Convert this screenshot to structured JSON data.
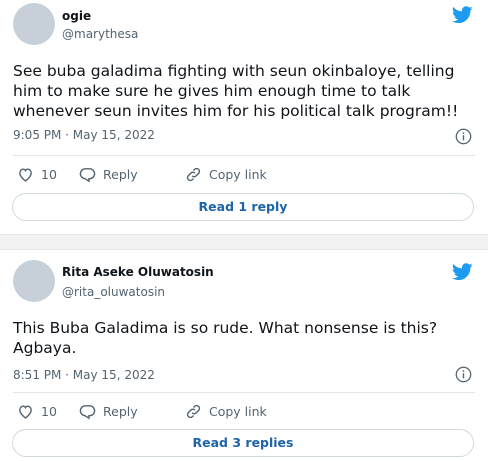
{
  "colors": {
    "twitter_blue": "#1d9bf0",
    "link_blue": "#1d64a8",
    "muted_text": "#536471",
    "avatar_placeholder": "#c7d0d8"
  },
  "tweets": [
    {
      "author_name": "ogie",
      "author_handle": "@marythesa",
      "text": "See buba galadima fighting with seun okinbaloye,  telling him to make sure he gives him enough time to talk whenever seun invites him for his political talk program!!",
      "timestamp": "9:05 PM · May 15, 2022",
      "like_count": "10",
      "reply_label": "Reply",
      "copy_link_label": "Copy link",
      "replies_button_label": "Read 1 reply",
      "icons": [
        "twitter-bird-icon",
        "info-icon",
        "heart-icon",
        "reply-icon",
        "link-icon"
      ]
    },
    {
      "author_name": "Rita Aseke Oluwatosin",
      "author_handle": "@rita_oluwatosin",
      "text": "This Buba Galadima is so rude. What nonsense is this? Agbaya.",
      "timestamp": "8:51 PM · May 15, 2022",
      "like_count": "10",
      "reply_label": "Reply",
      "copy_link_label": "Copy link",
      "replies_button_label": "Read 3 replies",
      "icons": [
        "twitter-bird-icon",
        "info-icon",
        "heart-icon",
        "reply-icon",
        "link-icon"
      ]
    }
  ]
}
